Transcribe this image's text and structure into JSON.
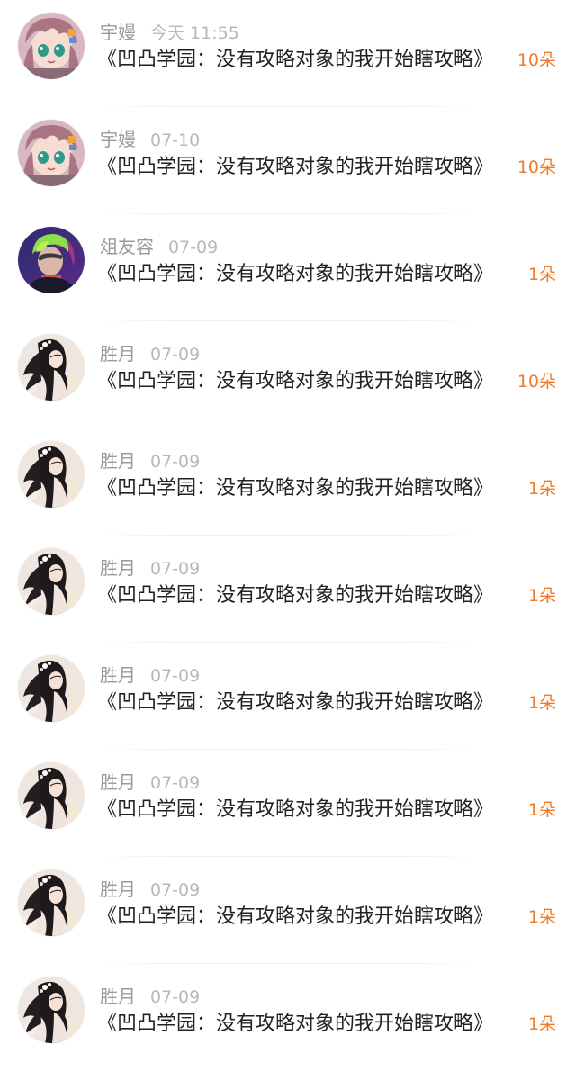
{
  "items": [
    {
      "avatar": "anime-pink-avatar",
      "name": "宇嫚",
      "time": "今天 11:55",
      "title": "《凹凸学园：没有攻略对象的我开始瞎攻略》",
      "count": "10朵"
    },
    {
      "avatar": "anime-pink-avatar",
      "name": "宇嫚",
      "time": "07-10",
      "title": "《凹凸学园：没有攻略对象的我开始瞎攻略》",
      "count": "10朵"
    },
    {
      "avatar": "neon-green-avatar",
      "name": "俎友容",
      "time": "07-09",
      "title": "《凹凸学园：没有攻略对象的我开始瞎攻略》",
      "count": "1朵"
    },
    {
      "avatar": "long-hair-girl-avatar",
      "name": "胜月",
      "time": "07-09",
      "title": "《凹凸学园：没有攻略对象的我开始瞎攻略》",
      "count": "10朵"
    },
    {
      "avatar": "long-hair-girl-avatar",
      "name": "胜月",
      "time": "07-09",
      "title": "《凹凸学园：没有攻略对象的我开始瞎攻略》",
      "count": "1朵"
    },
    {
      "avatar": "long-hair-girl-avatar",
      "name": "胜月",
      "time": "07-09",
      "title": "《凹凸学园：没有攻略对象的我开始瞎攻略》",
      "count": "1朵"
    },
    {
      "avatar": "long-hair-girl-avatar",
      "name": "胜月",
      "time": "07-09",
      "title": "《凹凸学园：没有攻略对象的我开始瞎攻略》",
      "count": "1朵"
    },
    {
      "avatar": "long-hair-girl-avatar",
      "name": "胜月",
      "time": "07-09",
      "title": "《凹凸学园：没有攻略对象的我开始瞎攻略》",
      "count": "1朵"
    },
    {
      "avatar": "long-hair-girl-avatar",
      "name": "胜月",
      "time": "07-09",
      "title": "《凹凸学园：没有攻略对象的我开始瞎攻略》",
      "count": "1朵"
    },
    {
      "avatar": "long-hair-girl-avatar",
      "name": "胜月",
      "time": "07-09",
      "title": "《凹凸学园：没有攻略对象的我开始瞎攻略》",
      "count": "1朵"
    }
  ],
  "colors": {
    "count": "#f07c2a",
    "name": "#9a9a9a",
    "time": "#b8b8b8",
    "title": "#222222"
  }
}
